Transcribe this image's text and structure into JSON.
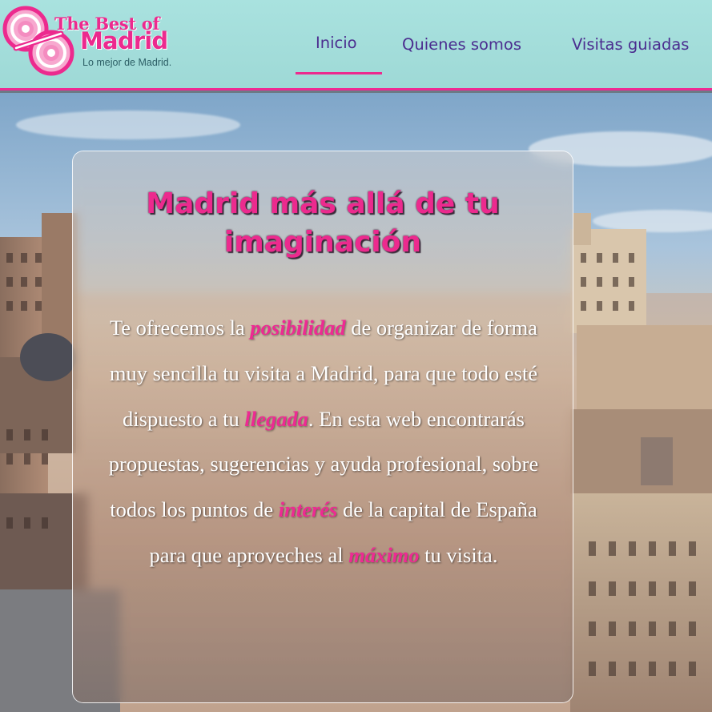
{
  "header": {
    "logo": {
      "line1": "The Best of",
      "line2": "Madrid",
      "tagline": "Lo mejor de Madrid."
    },
    "nav": [
      {
        "label": "Inicio",
        "active": true
      },
      {
        "label": "Quienes somos",
        "active": false
      },
      {
        "label": "Visitas guiadas",
        "active": false
      }
    ]
  },
  "hero": {
    "title_line1": "Madrid más allá de tu",
    "title_line2": "imaginación",
    "paragraph": [
      {
        "text": "Te ofrecemos la "
      },
      {
        "text": "posibilidad",
        "highlight": true
      },
      {
        "text": " de organizar de forma muy sencilla tu visita a Madrid, para que todo esté dispuesto a tu "
      },
      {
        "text": "llegada",
        "highlight": true
      },
      {
        "text": ". En esta web encontrarás propuestas, sugerencias y ayuda profesional, sobre todos los puntos de "
      },
      {
        "text": "interés",
        "highlight": true
      },
      {
        "text": " de la capital de España para que aproveches al "
      },
      {
        "text": "máximo",
        "highlight": true
      },
      {
        "text": " tu visita."
      }
    ]
  },
  "colors": {
    "accent": "#ec2a8e",
    "header_bg": "#a9e2df",
    "nav_text": "#4b2d8f"
  }
}
